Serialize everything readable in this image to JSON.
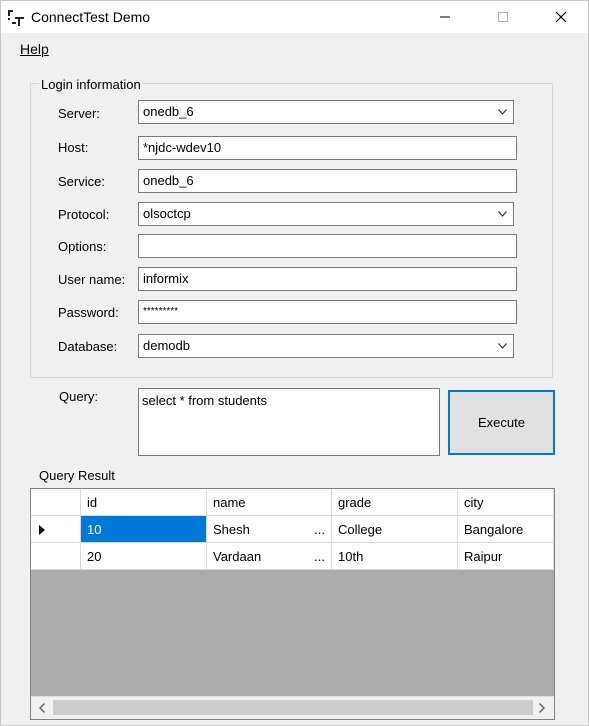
{
  "window": {
    "title": "ConnectTest Demo",
    "icons": [
      "app-icon",
      "minimize-icon",
      "maximize-icon",
      "close-icon"
    ]
  },
  "menu": {
    "help_label": "Help"
  },
  "login": {
    "group_title": "Login information",
    "server_label": "Server:",
    "server_value": "onedb_6",
    "host_label": "Host:",
    "host_value": "*njdc-wdev10",
    "service_label": "Service:",
    "service_value": "onedb_6",
    "protocol_label": "Protocol:",
    "protocol_value": "olsoctcp",
    "options_label": "Options:",
    "options_value": "",
    "username_label": "User name:",
    "username_value": "informix",
    "password_label": "Password:",
    "password_value": "*********",
    "database_label": "Database:",
    "database_value": "demodb"
  },
  "query": {
    "label": "Query:",
    "text": "select * from students",
    "execute_label": "Execute"
  },
  "result": {
    "label": "Query Result",
    "columns": [
      "id",
      "name",
      "grade",
      "city"
    ],
    "rows": [
      [
        "10",
        "Shesh",
        "College",
        "Bangalore"
      ],
      [
        "20",
        "Vardaan",
        "10th",
        "Raipur"
      ]
    ],
    "ellipsis": "...",
    "current_row_marker_icon": "row-pointer-icon",
    "scroll_icons": [
      "scroll-left-icon",
      "scroll-right-icon"
    ]
  },
  "colors": {
    "selection": "#0078d7",
    "grid_empty": "#ababab",
    "window_bg": "#f0f0f0"
  }
}
